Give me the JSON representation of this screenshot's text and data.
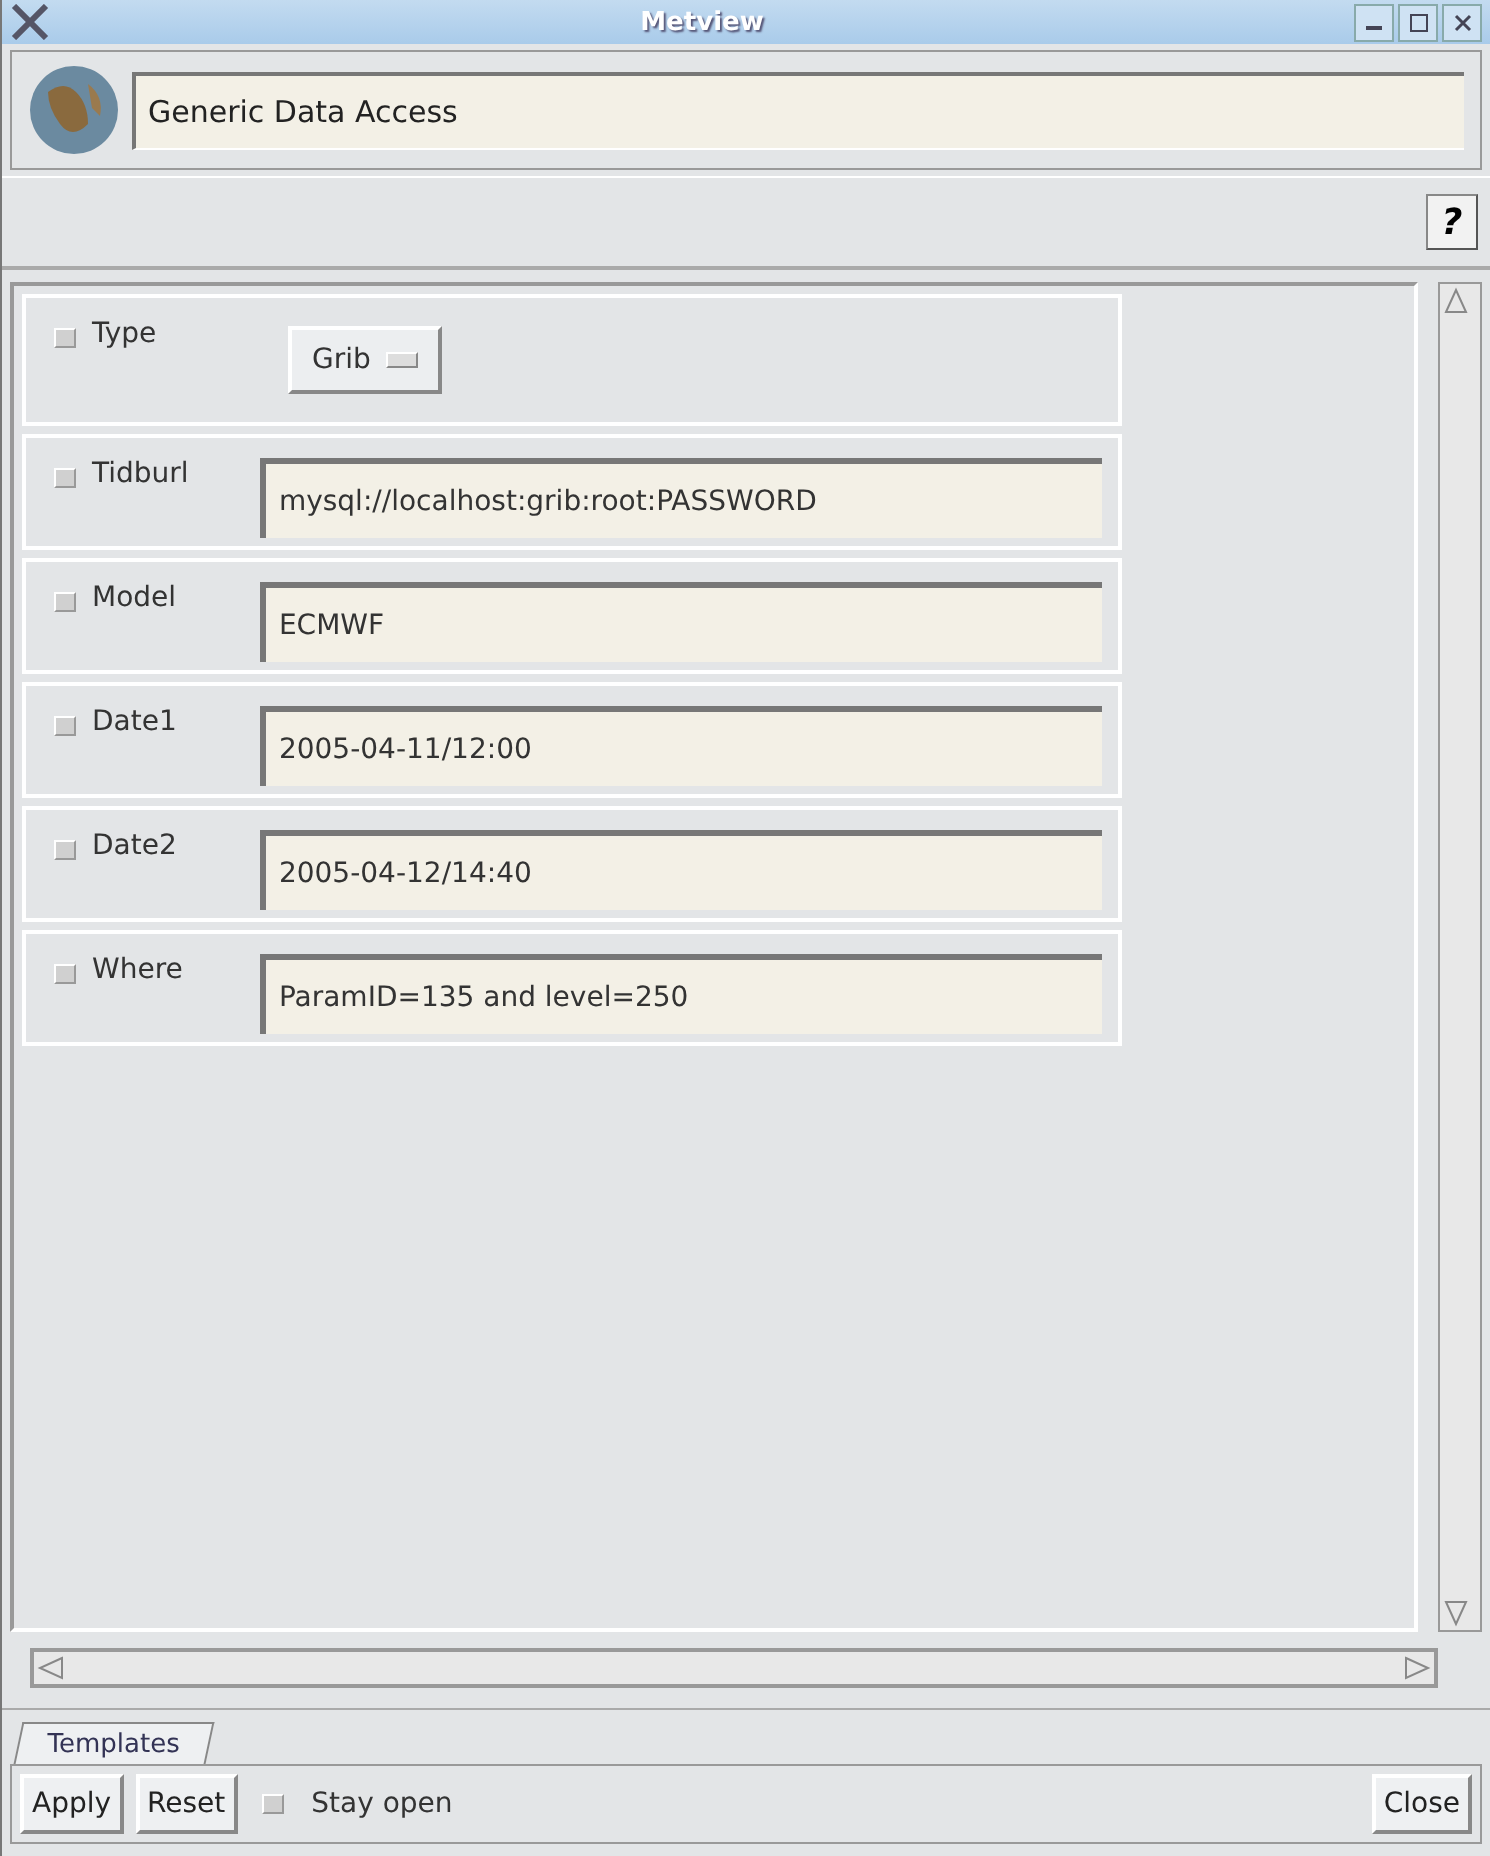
{
  "window": {
    "title": "Metview"
  },
  "header": {
    "title_value": "Generic Data Access"
  },
  "help_button": "?",
  "parameters": [
    {
      "kind": "option",
      "label": "Type",
      "checked": false,
      "value": "Grib"
    },
    {
      "kind": "text",
      "label": "Tidburl",
      "checked": false,
      "value": "mysql://localhost:grib:root:PASSWORD"
    },
    {
      "kind": "text",
      "label": "Model",
      "checked": false,
      "value": "ECMWF"
    },
    {
      "kind": "text",
      "label": "Date1",
      "checked": false,
      "value": "2005-04-11/12:00"
    },
    {
      "kind": "text",
      "label": "Date2",
      "checked": false,
      "value": "2005-04-12/14:40"
    },
    {
      "kind": "text",
      "label": "Where",
      "checked": false,
      "value": "ParamID=135 and level=250"
    }
  ],
  "tabs": [
    {
      "label": "Templates",
      "selected": true
    }
  ],
  "footer": {
    "apply": "Apply",
    "reset": "Reset",
    "stay_open": {
      "label": "Stay open",
      "checked": false
    },
    "close": "Close"
  }
}
